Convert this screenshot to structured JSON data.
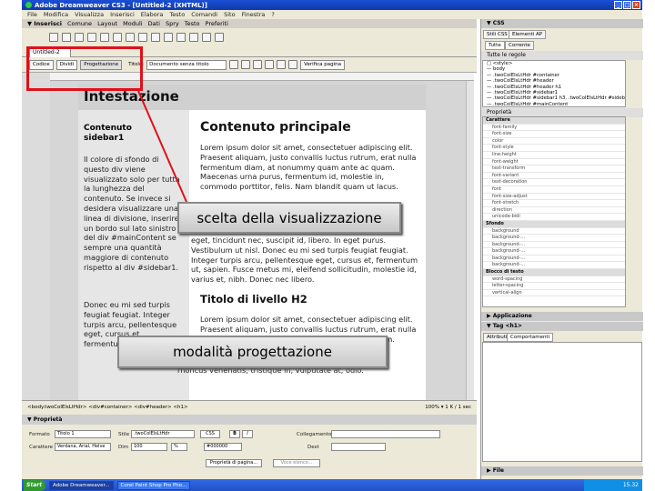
{
  "window": {
    "title": "Adobe Dreamweaver CS3 - [Untitled-2 (XHTML)]",
    "controls": [
      "_",
      "□",
      "×"
    ]
  },
  "menu": [
    "File",
    "Modifica",
    "Visualizza",
    "Inserisci",
    "Elabora",
    "Testo",
    "Comandi",
    "Sito",
    "Finestra",
    "?"
  ],
  "insert_bar": {
    "title": "▼ Inserisci",
    "tabs": [
      "Comune",
      "Layout",
      "Moduli",
      "Dati",
      "Spry",
      "Testo",
      "Preferiti"
    ]
  },
  "document": {
    "tab": "Untitled-2",
    "views": {
      "code": "Codice",
      "split": "Dividi",
      "design": "Progettazione"
    },
    "title_label": "Titolo:",
    "title_value": "Documento senza titolo",
    "check_page": "Verifica pagina"
  },
  "page": {
    "header": "Intestazione",
    "sidebar_title": "Contenuto sidebar1",
    "sidebar_text": "Il colore di sfondo di questo div viene visualizzato solo per tutta la lunghezza del contenuto. Se invece si desidera visualizzare una linea di divisione, inserire un bordo sul lato sinistro del div #mainContent se sempre una quantità maggiore di contenuto rispetto al div #sidebar1.",
    "sidebar_text2": "Donec eu mi sed turpis feugiat feugiat. Integer turpis arcu, pellentesque eget, cursus et, fermentum ut, sapien.",
    "main_title": "Contenuto principale",
    "main_p1": "Lorem ipsum dolor sit amet, consectetuer adipiscing elit. Praesent aliquam, justo convallis luctus rutrum, erat nulla fermentum diam, at nonummy quam ante ac quam. Maecenas urna purus, fermentum id, molestie in, commodo porttitor, felis. Nam blandit quam ut lacus.",
    "main_p2": "eget, tincidunt nec, suscipit id, libero. In eget purus. Vestibulum ut nisl. Donec eu mi sed turpis feugiat feugiat. Integer turpis arcu, pellentesque eget, cursus et, fermentum ut, sapien. Fusce metus mi, eleifend sollicitudin, molestie id, varius et, nibh. Donec nec libero.",
    "main_h2": "Titolo di livello H2",
    "main_p3": "Lorem ipsum dolor sit amet, consectetuer adipiscing elit. Praesent aliquam, justo convallis luctus rutrum, erat nulla fermentum diam, at nonummy quam ante ac quam.",
    "main_p4": "rhoncus venenatis, tristique in, vulputate at, odio."
  },
  "status": {
    "tags": "<body.twoColElsLtHdr> <div#container> <div#header> <h1>",
    "info": "100%  ▾  1 K / 1 sec"
  },
  "properties": {
    "title": "▼ Proprietà",
    "format_label": "Formato",
    "format_value": "Titolo 1",
    "style_label": "Stile",
    "style_value": ".twoColElsLtHdr",
    "css_btn": "CSS",
    "link_label": "Collegamento",
    "font_label": "Carattere",
    "font_value": "Verdana, Arial, Helve",
    "size_label": "Dim",
    "size_value": "100",
    "size_unit": "%",
    "color_value": "#000000",
    "target_label": "Dest",
    "page_props_btn": "Proprietà di pagina...",
    "list_item_btn": "Voce elenco..."
  },
  "right_panel": {
    "css_header": "▼ CSS",
    "css_tabs": [
      "Stili CSS",
      "Elementi AP"
    ],
    "mode_tabs": [
      "Tutte",
      "Corrente"
    ],
    "all_rules_label": "Tutte le regole",
    "rules": [
      "□ <style>",
      "  — body",
      "  — .twoColElsLtHdr #container",
      "  — .twoColElsLtHdr #header",
      "  — .twoColElsLtHdr #header h1",
      "  — .twoColElsLtHdr #sidebar1",
      "  — .twoColElsLtHdr #sidebar1 h3, .twoColElsLtHdr #sideb",
      "  — .twoColElsLtHdr #mainContent"
    ],
    "properties_label": "Proprietà",
    "property_rows": [
      {
        "name": "Carattere",
        "cat": true
      },
      {
        "name": "font-family",
        "cat": false
      },
      {
        "name": "font-size",
        "cat": false
      },
      {
        "name": "color",
        "cat": false
      },
      {
        "name": "font-style",
        "cat": false
      },
      {
        "name": "line-height",
        "cat": false
      },
      {
        "name": "font-weight",
        "cat": false
      },
      {
        "name": "text-transform",
        "cat": false
      },
      {
        "name": "font-variant",
        "cat": false
      },
      {
        "name": "text-decoration",
        "cat": false
      },
      {
        "name": "font",
        "cat": false
      },
      {
        "name": "font-size-adjust",
        "cat": false
      },
      {
        "name": "font-stretch",
        "cat": false
      },
      {
        "name": "direction",
        "cat": false
      },
      {
        "name": "unicode-bidi",
        "cat": false
      },
      {
        "name": "Sfondo",
        "cat": true
      },
      {
        "name": "background",
        "cat": false
      },
      {
        "name": "background-...",
        "cat": false
      },
      {
        "name": "background-...",
        "cat": false
      },
      {
        "name": "background-...",
        "cat": false
      },
      {
        "name": "background-...",
        "cat": false
      },
      {
        "name": "background-...",
        "cat": false
      },
      {
        "name": "Blocco di testo",
        "cat": true
      },
      {
        "name": "word-spacing",
        "cat": false
      },
      {
        "name": "letter-spacing",
        "cat": false
      },
      {
        "name": "vertical-align",
        "cat": false
      }
    ],
    "app_header": "▶ Applicazione",
    "tag_header": "▼ Tag <h1>",
    "tag_tabs": [
      "Attributi",
      "Comportamenti"
    ],
    "files_header": "▶ File"
  },
  "taskbar": {
    "start": "Start",
    "items": [
      "Adobe Dreamweaver...",
      "Corel Paint Shop Pro Pho..."
    ],
    "clock": "15.32"
  },
  "annotations": {
    "callout_view_choice": "scelta della visualizzazione",
    "callout_design_mode": "modalità progettazione",
    "highlight_color": "#e0101a"
  }
}
